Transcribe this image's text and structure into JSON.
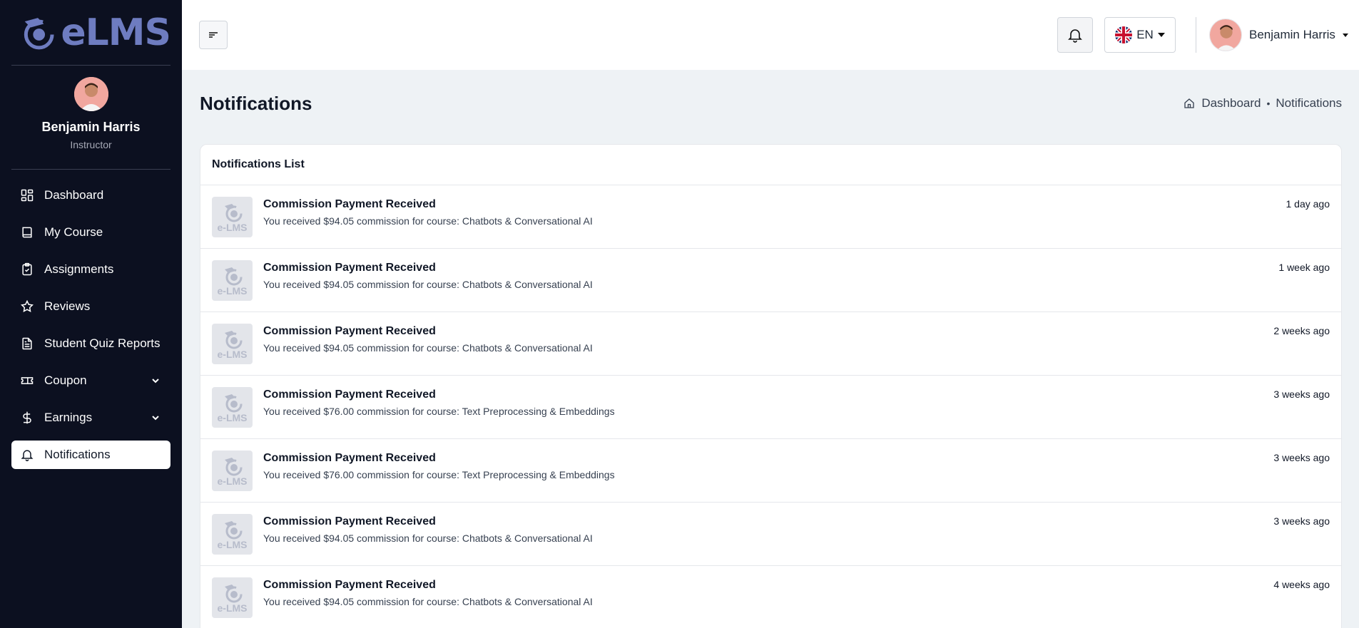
{
  "app": {
    "logo_text": "eLMS"
  },
  "user": {
    "name": "Benjamin Harris",
    "role": "Instructor"
  },
  "sidebar": {
    "items": [
      {
        "label": "Dashboard",
        "icon": "dashboard-icon"
      },
      {
        "label": "My Course",
        "icon": "book-icon"
      },
      {
        "label": "Assignments",
        "icon": "clipboard-icon"
      },
      {
        "label": "Reviews",
        "icon": "star-icon"
      },
      {
        "label": "Student Quiz Reports",
        "icon": "document-icon"
      },
      {
        "label": "Coupon",
        "icon": "ticket-icon"
      },
      {
        "label": "Earnings",
        "icon": "dollar-icon"
      },
      {
        "label": "Notifications",
        "icon": "bell-icon"
      }
    ]
  },
  "topbar": {
    "language": "EN",
    "user_name": "Benjamin Harris"
  },
  "page": {
    "title": "Notifications"
  },
  "breadcrumb": {
    "home": "Dashboard",
    "current": "Notifications",
    "separator": "•"
  },
  "card": {
    "title": "Notifications List",
    "thumb_text": "e-LMS"
  },
  "notifications": [
    {
      "title": "Commission Payment Received",
      "body": "You received $94.05 commission for course: Chatbots & Conversational AI",
      "time": "1 day ago"
    },
    {
      "title": "Commission Payment Received",
      "body": "You received $94.05 commission for course: Chatbots & Conversational AI",
      "time": "1 week ago"
    },
    {
      "title": "Commission Payment Received",
      "body": "You received $94.05 commission for course: Chatbots & Conversational AI",
      "time": "2 weeks ago"
    },
    {
      "title": "Commission Payment Received",
      "body": "You received $76.00 commission for course: Text Preprocessing & Embeddings",
      "time": "3 weeks ago"
    },
    {
      "title": "Commission Payment Received",
      "body": "You received $76.00 commission for course: Text Preprocessing & Embeddings",
      "time": "3 weeks ago"
    },
    {
      "title": "Commission Payment Received",
      "body": "You received $94.05 commission for course: Chatbots & Conversational AI",
      "time": "3 weeks ago"
    },
    {
      "title": "Commission Payment Received",
      "body": "You received $94.05 commission for course: Chatbots & Conversational AI",
      "time": "4 weeks ago"
    }
  ],
  "colors": {
    "sidebar_bg": "#0c1020",
    "logo": "#6e7cc0",
    "page_bg": "#eef2f5"
  }
}
